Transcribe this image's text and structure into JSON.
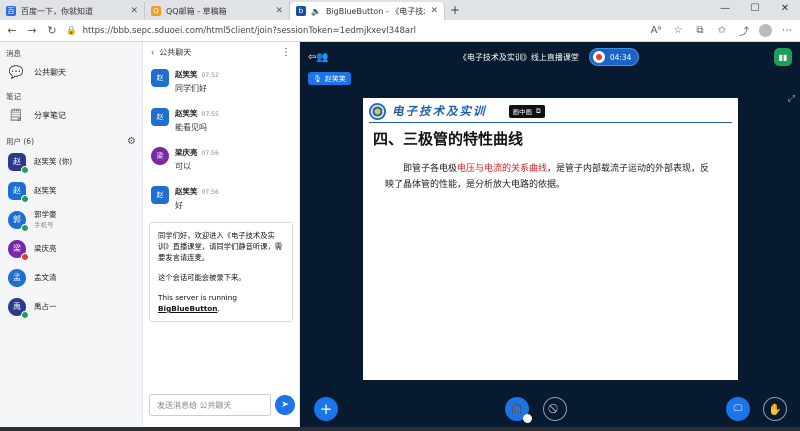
{
  "browser": {
    "tabs": [
      {
        "title": "百度一下，你就知道",
        "favicon": "baidu-icon",
        "fav_char": "百",
        "fav_color": "#2f6be0"
      },
      {
        "title": "QQ邮箱 - 草稿箱",
        "favicon": "qq-mail-icon",
        "fav_char": "Q",
        "fav_color": "#f0a020"
      },
      {
        "title": "BigBlueButton - 《电子技术",
        "favicon": "bbb-icon",
        "fav_char": "b",
        "fav_color": "#1b4f9e"
      }
    ],
    "url": "https://bbb.sepc.sduoei.com/html5client/join?sessionToken=1edmjkxevl348arl"
  },
  "sidebar": {
    "messages_title": "消息",
    "public_chat": "公共聊天",
    "notes_title": "笔记",
    "shared_notes": "分享笔记",
    "users_title": "用户 (6)",
    "users": [
      {
        "name": "赵笑笑 (你)",
        "sub": "",
        "initial": "赵",
        "color": "#2b3a8c",
        "square": true,
        "dot": "#1e9e5a"
      },
      {
        "name": "赵笑笑",
        "sub": "",
        "initial": "赵",
        "color": "#1e6fd0",
        "square": true,
        "dot": "#1e9e5a"
      },
      {
        "name": "郭学豪",
        "sub": "手机号",
        "initial": "郭",
        "color": "#1e6fd0",
        "square": false,
        "dot": "#1e9e5a"
      },
      {
        "name": "梁庆亮",
        "sub": "",
        "initial": "梁",
        "color": "#7a27a8",
        "square": false,
        "dot": "#d93a3a"
      },
      {
        "name": "孟文清",
        "sub": "",
        "initial": "孟",
        "color": "#1e6fd0",
        "square": false,
        "dot": ""
      },
      {
        "name": "禹占一",
        "sub": "",
        "initial": "禹",
        "color": "#2b3a8c",
        "square": false,
        "dot": "#1e9e5a"
      }
    ]
  },
  "chat": {
    "title": "公共聊天",
    "messages": [
      {
        "name": "赵笑笑",
        "time": "07:52",
        "text": "同学们好",
        "initial": "赵",
        "color": "#1e6fd0",
        "round": false
      },
      {
        "name": "赵笑笑",
        "time": "07:55",
        "text": "能看见吗",
        "initial": "赵",
        "color": "#1e6fd0",
        "round": false
      },
      {
        "name": "梁庆亮",
        "time": "07:56",
        "text": "可以",
        "initial": "梁",
        "color": "#7a27a8",
        "round": true
      },
      {
        "name": "赵笑笑",
        "time": "07:56",
        "text": "好",
        "initial": "赵",
        "color": "#1e6fd0",
        "round": false
      }
    ],
    "welcome_line1": "同学们好，欢迎进入《电子技术及实训》直播课堂，请同学们静音听课，需要发言请连麦。",
    "welcome_line2": "这个会话可能会被录下来。",
    "welcome_line3_prefix": "This server is running ",
    "welcome_line3_link": "BigBlueButton",
    "welcome_line3_suffix": ".",
    "input_placeholder": "发送消息给 公共聊天"
  },
  "meeting": {
    "title": "《电子技术及实训》线上直播课堂",
    "timer": "04:34",
    "talker": "赵笑笑"
  },
  "slide": {
    "brand": "电子技术及实训",
    "pip_label": "画中画",
    "heading": "四、三极管的特性曲线",
    "body_prefix": "即管子各电极",
    "body_highlight": "电压与电流的关系曲线",
    "body_suffix": "，是管子内部载流子运动的外部表现，反映了晶体管的性能，是分析放大电路的依据。"
  },
  "colors": {
    "accent": "#1b74e8",
    "main_bg": "#081a30",
    "highlight_red": "#d91d1d"
  }
}
